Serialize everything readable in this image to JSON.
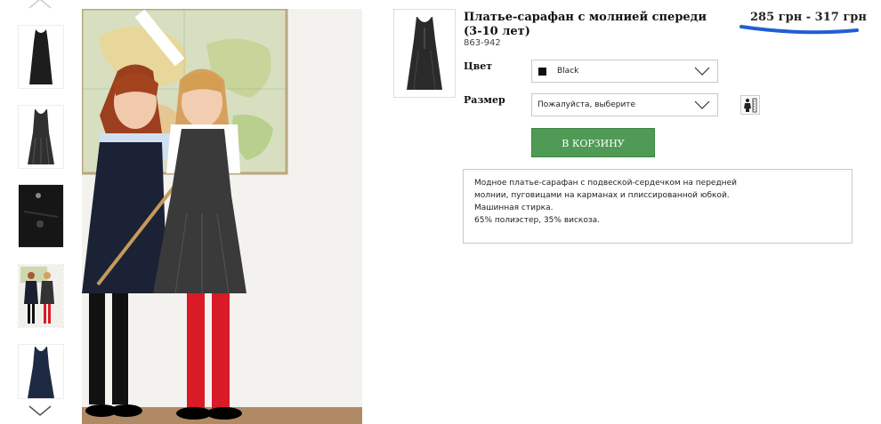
{
  "product": {
    "title": "Платье-сарафан с молнией спереди (3-10 лет)",
    "sku": "863-942",
    "price": "285 грн - 317 грн"
  },
  "color": {
    "label": "Цвет",
    "value": "Black",
    "swatch_color": "#111111"
  },
  "size": {
    "label": "Размер",
    "placeholder": "Пожалуйста, выберите"
  },
  "cart_button": {
    "label": "В КОРЗИНУ",
    "color": "#4f9a55"
  },
  "description": {
    "lines": [
      "Модное платье-сарафан с подвеской-сердечком на передней",
      "молнии, пуговицами на карманах и плиссированной юбкой.",
      "Машинная стирка.",
      "65% полиэстер, 35% вискоза."
    ]
  },
  "gallery": {
    "icons": {
      "up": "chevron-up-icon",
      "down": "chevron-down-icon"
    },
    "thumbnails": [
      "black-pinafore-front",
      "grey-pinafore-front",
      "pocket-button-detail",
      "girls-lifestyle",
      "navy-pinafore-front"
    ]
  },
  "accent_colors": {
    "price_underline": "#1d5fd4",
    "cart_green": "#4f9a55"
  }
}
